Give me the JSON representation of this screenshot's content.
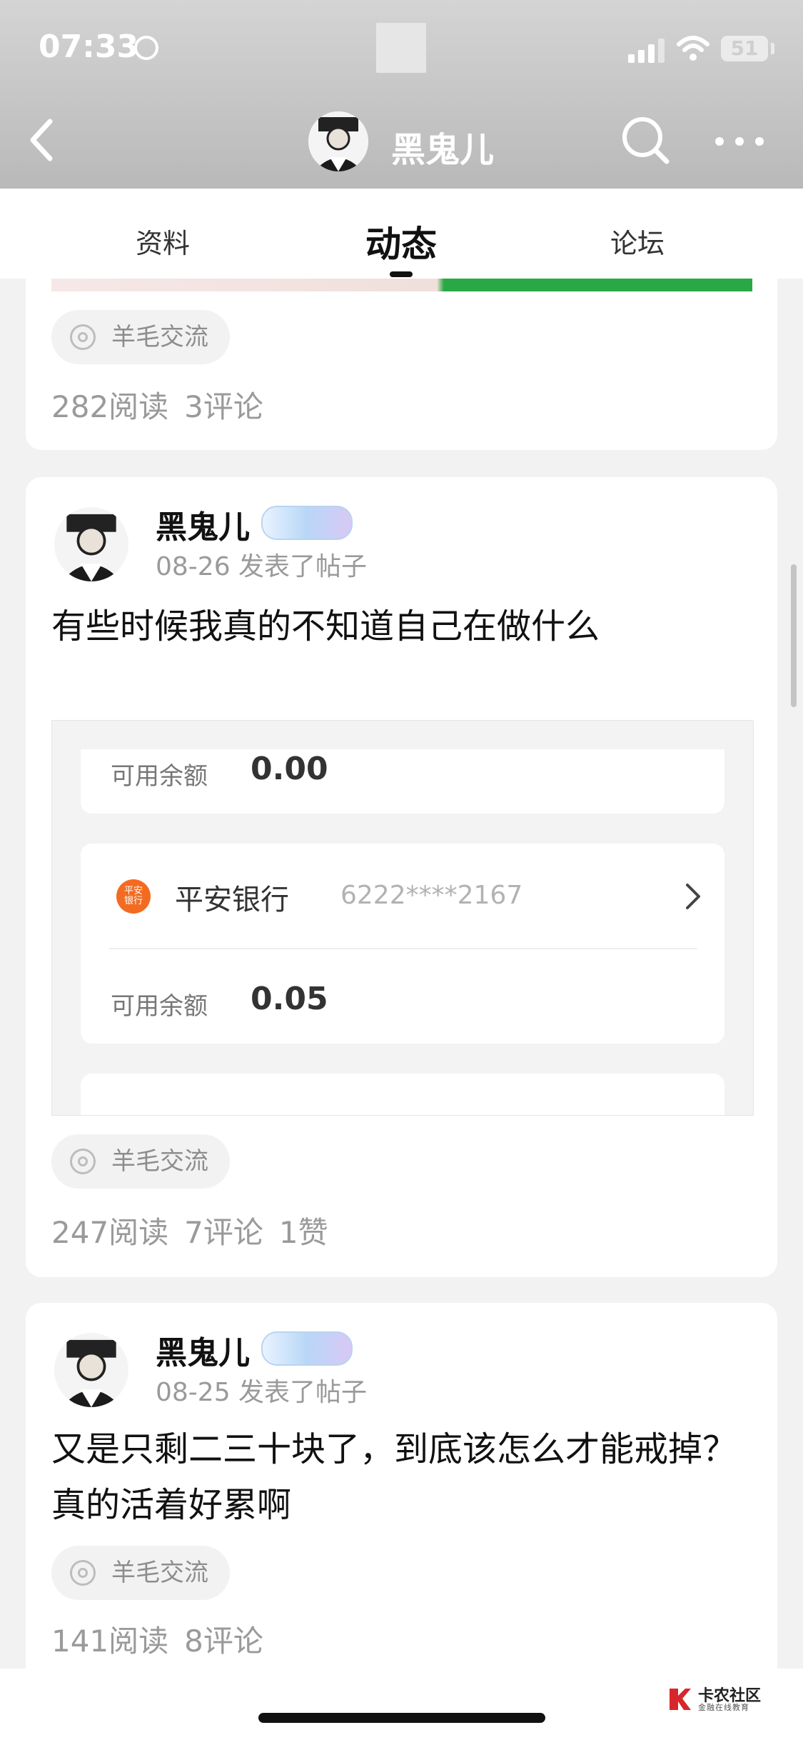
{
  "status_bar": {
    "time": "07:33",
    "battery": "51"
  },
  "header": {
    "title": "黑鬼儿"
  },
  "tabs": [
    {
      "label": "资料"
    },
    {
      "label": "动态"
    },
    {
      "label": "论坛"
    }
  ],
  "active_tab": "动态",
  "posts": [
    {
      "tag": "羊毛交流",
      "stats": {
        "reads": "282阅读",
        "comments": "3评论"
      }
    },
    {
      "author": "黑鬼儿",
      "meta": "08-26 发表了帖子",
      "title": "有些时候我真的不知道自己在做什么",
      "embedded": {
        "label_1": "可用余额",
        "amount_1": "0.00",
        "bank_name": "平安银行",
        "bank_logo_text": "平安\n银行",
        "card_number": "6222****2167",
        "label_2": "可用余额",
        "amount_2": "0.05"
      },
      "tag": "羊毛交流",
      "stats": {
        "reads": "247阅读",
        "comments": "7评论",
        "likes": "1赞"
      }
    },
    {
      "author": "黑鬼儿",
      "meta": "08-25 发表了帖子",
      "title": "又是只剩二三十块了，到底该怎么才能戒掉？真的活着好累啊",
      "tag": "羊毛交流",
      "stats": {
        "reads": "141阅读",
        "comments": "8评论"
      }
    }
  ],
  "watermark": {
    "name": "卡农社区",
    "sub": "金融在线教育"
  }
}
